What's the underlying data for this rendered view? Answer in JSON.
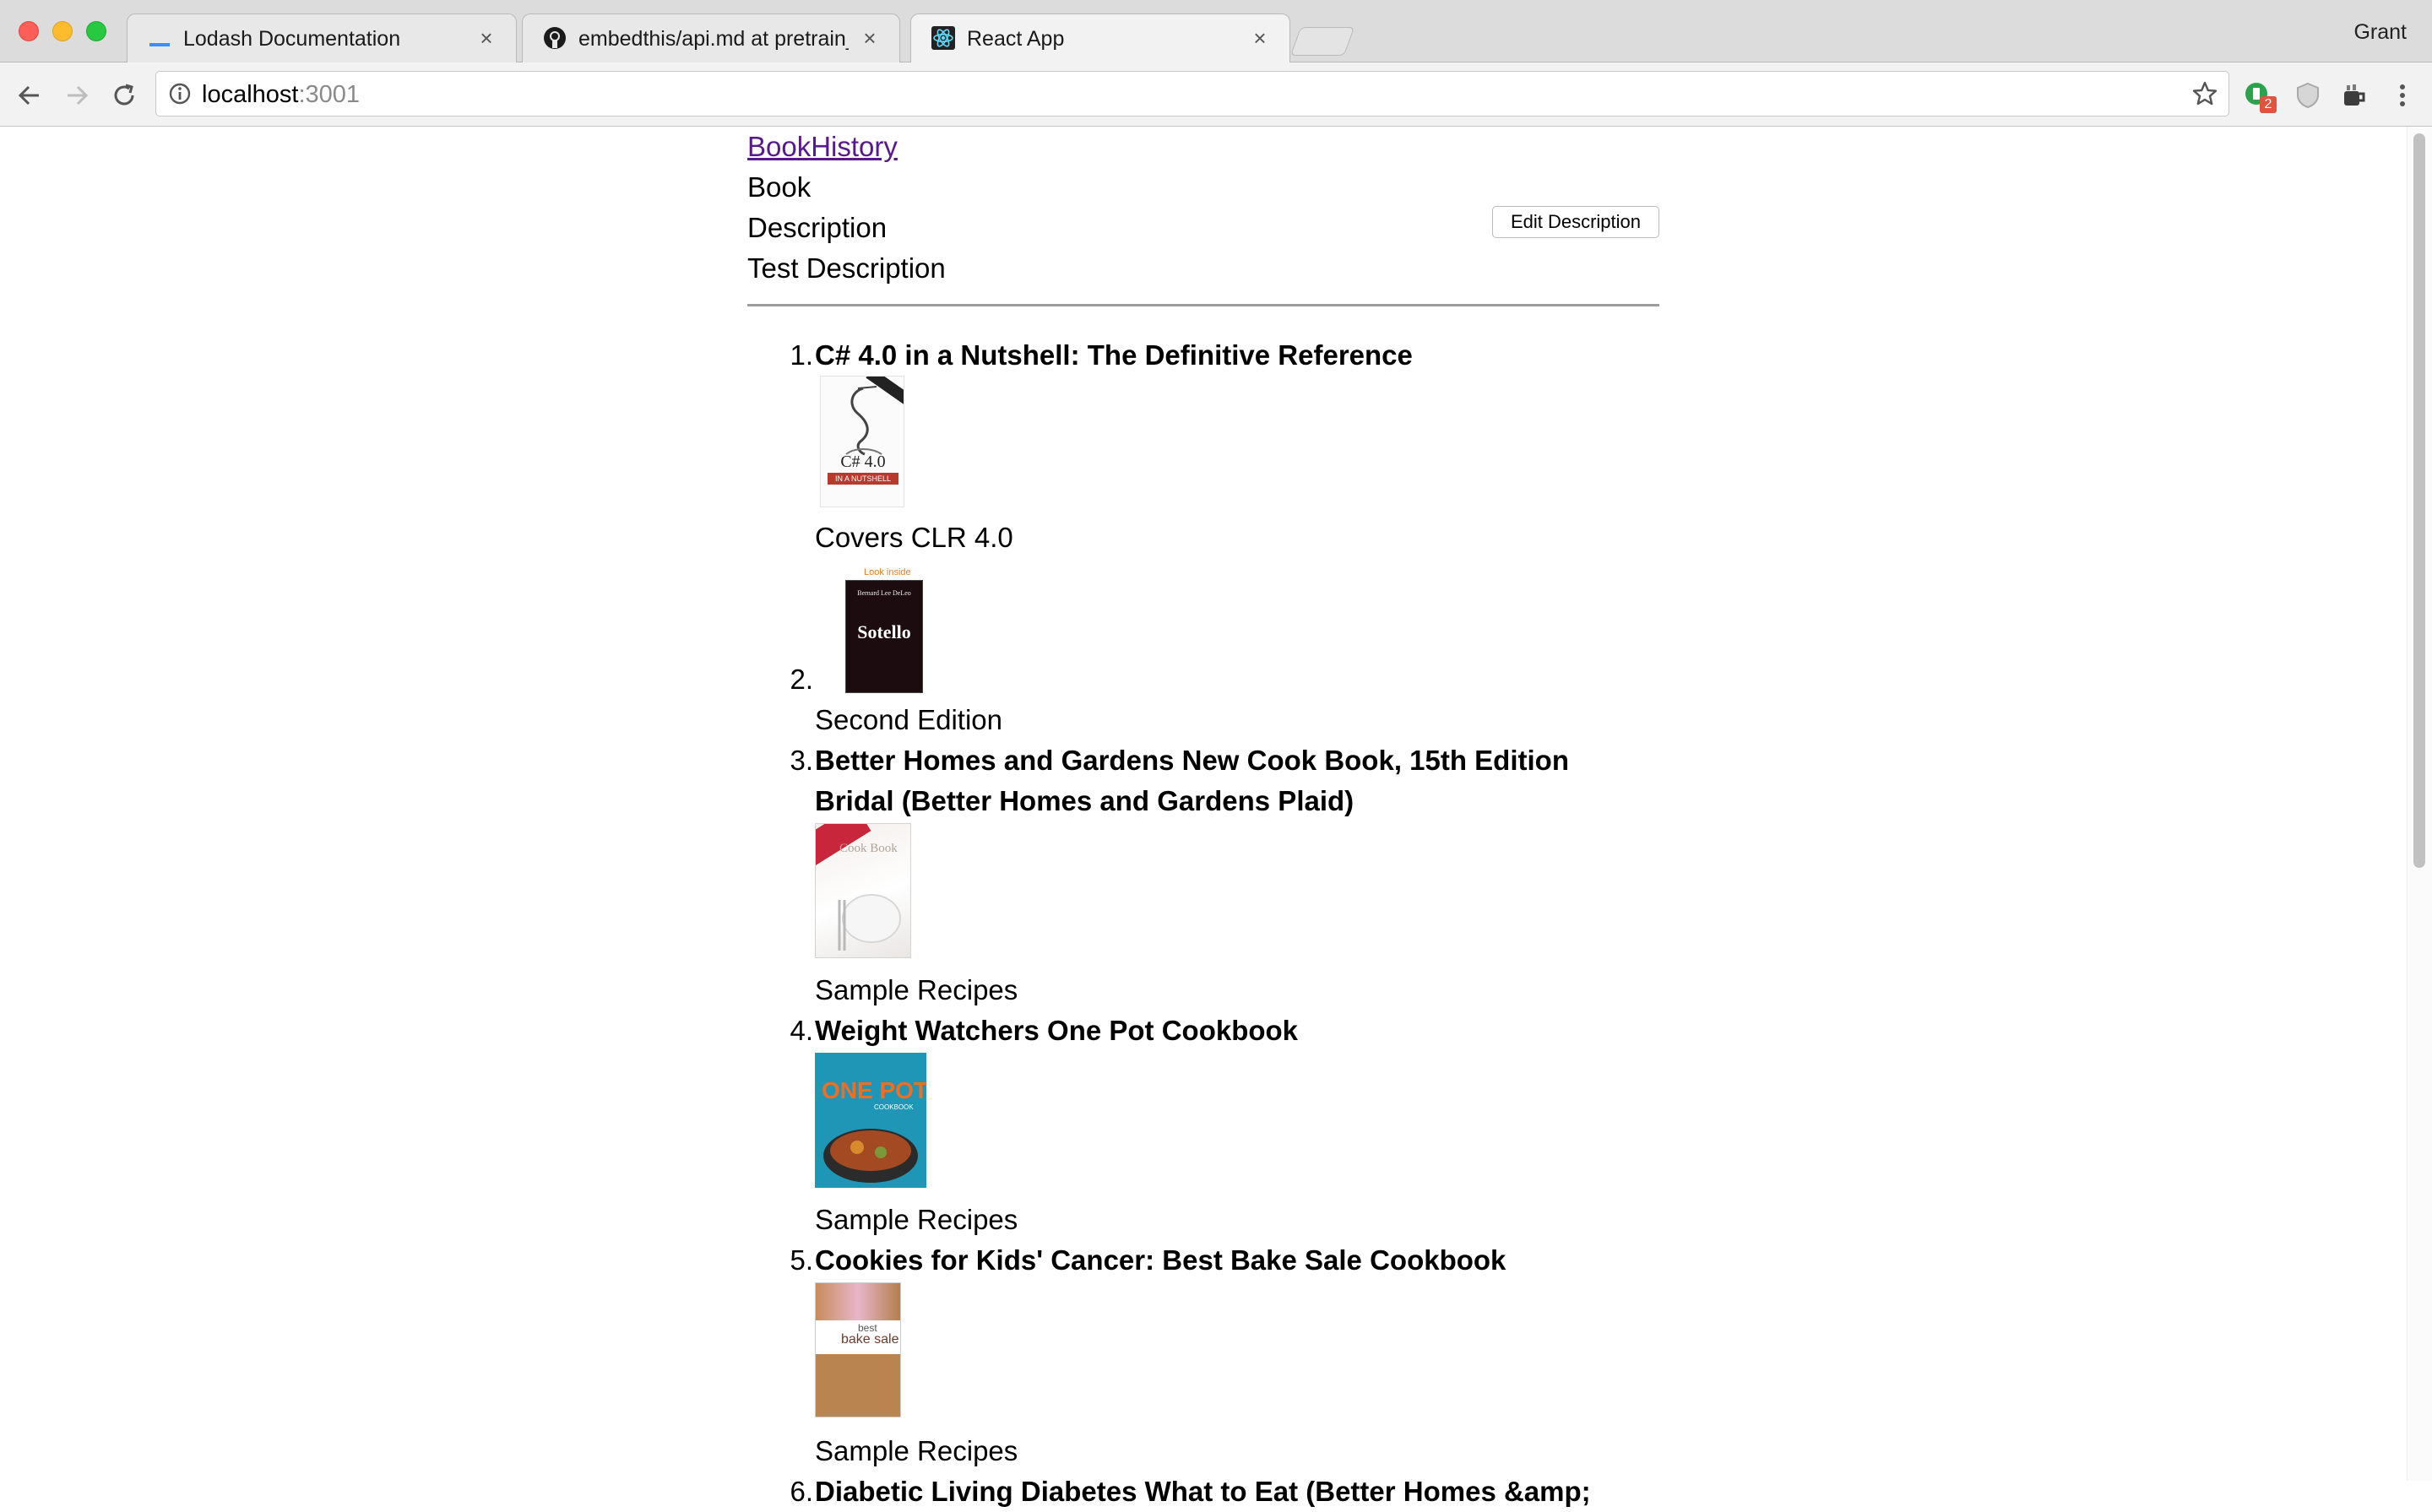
{
  "browser": {
    "tabs": [
      {
        "title": "Lodash Documentation"
      },
      {
        "title": "embedthis/api.md at pretrain_e"
      },
      {
        "title": "React App"
      }
    ],
    "profile_name": "Grant",
    "url_host": "localhost",
    "url_port": ":3001",
    "extension_badge": "2"
  },
  "page": {
    "brand": "BookHistory",
    "book_label": "Book",
    "description_label": "Description",
    "description_value": "Test Description",
    "edit_button": "Edit Description"
  },
  "books": [
    {
      "number": "1.",
      "title": "C# 4.0 in a Nutshell: The Definitive Reference",
      "cover_text": "C# 4.0",
      "cover_subtext": "IN A NUTSHELL",
      "description": "Covers CLR 4.0"
    },
    {
      "number": "2.",
      "title": "",
      "cover_text": "Sotello",
      "cover_subtext": "Bernard Lee DeLeo",
      "cover_badge": "Look inside",
      "description": "Second Edition"
    },
    {
      "number": "3.",
      "title": "Better Homes and Gardens New Cook Book, 15th Edition Bridal (Better Homes and Gardens Plaid)",
      "cover_text": "Cook Book",
      "description": "Sample Recipes"
    },
    {
      "number": "4.",
      "title": "Weight Watchers One Pot Cookbook",
      "cover_text": "ONE POT",
      "cover_subtext": "COOKBOOK",
      "description": "Sample Recipes"
    },
    {
      "number": "5.",
      "title": "Cookies for Kids' Cancer: Best Bake Sale Cookbook",
      "cover_text": "bake sale",
      "cover_subtext": "best",
      "description": "Sample Recipes"
    },
    {
      "number": "6.",
      "title": "Diabetic Living Diabetes What to Eat (Better Homes &amp;",
      "description": ""
    }
  ]
}
